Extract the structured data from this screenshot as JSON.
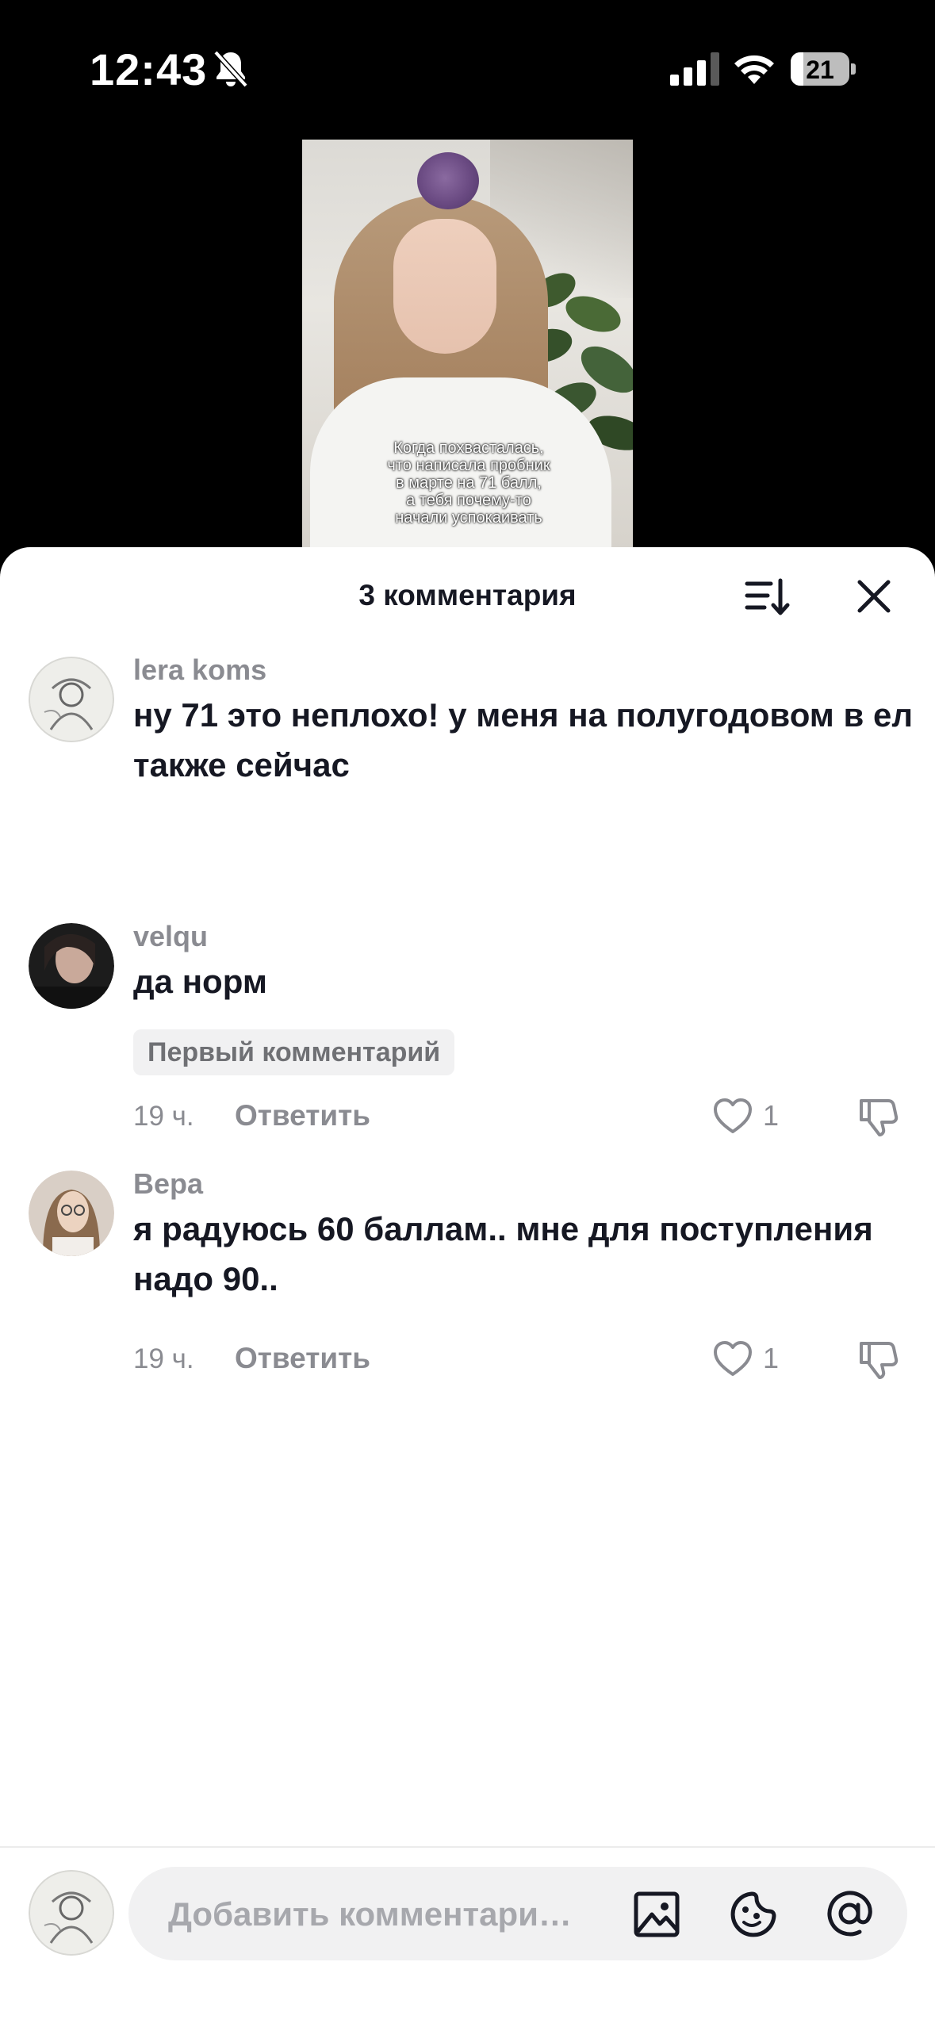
{
  "status_bar": {
    "time": "12:43",
    "battery": "21",
    "icons": [
      "bell-off-icon",
      "signal-icon",
      "wifi-icon",
      "battery-icon"
    ]
  },
  "video": {
    "caption_lines": [
      "Когда похвасталась,",
      "что написала пробник",
      "в марте на 71 балл,",
      "а тебя почему-то",
      "начали успокаивать"
    ]
  },
  "sheet": {
    "title": "3 комментария",
    "icons": [
      "sort-icon",
      "close-icon"
    ]
  },
  "comments": [
    {
      "username": "lera koms",
      "text": "ну 71 это неплохо! у меня на полугодовом в ел также сейчас"
    },
    {
      "username": "velqu",
      "text": "да норм",
      "badge": "Первый комментарий",
      "time": "19 ч.",
      "reply": "Ответить",
      "likes": "1"
    },
    {
      "username": "Вера",
      "text": "я радуюсь 60 баллам.. мне для поступления надо 90..",
      "time": "19 ч.",
      "reply": "Ответить",
      "likes": "1"
    }
  ],
  "input": {
    "placeholder": "Добавить комментари…",
    "icons": [
      "image-icon",
      "emoji-icon",
      "mention-icon"
    ]
  },
  "colors": {
    "text_primary": "#161823",
    "text_secondary": "#8a8b91",
    "input_bg": "#f1f1f2"
  }
}
